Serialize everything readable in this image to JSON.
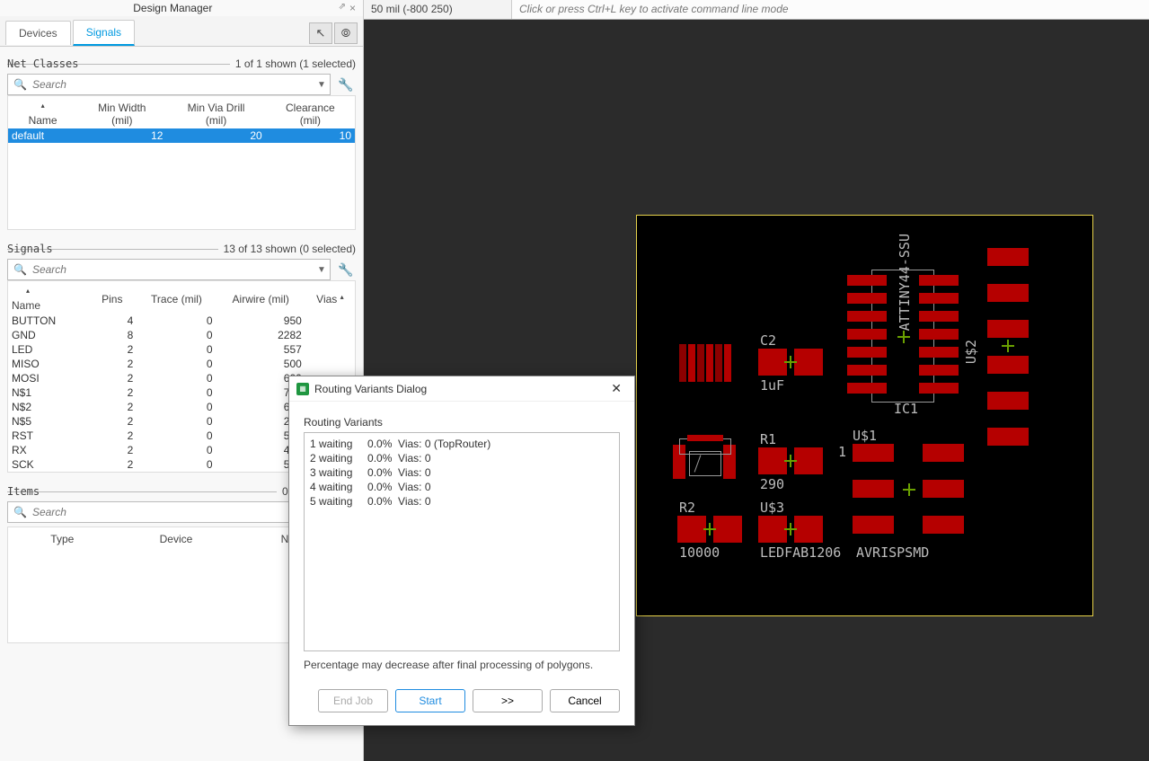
{
  "panel": {
    "title": "Design Manager",
    "pin_icon": "📌",
    "close_icon": "×"
  },
  "tabs": {
    "devices": "Devices",
    "signals": "Signals",
    "active": "signals"
  },
  "toolbar": {
    "select_icon": "↖",
    "fit_icon": "🔍"
  },
  "searchPlaceholder": "Search",
  "netClasses": {
    "label": "Net Classes",
    "meta": "1 of 1 shown (1 selected)",
    "headers": {
      "name": "Name",
      "minWidth": "Min Width\n(mil)",
      "minVia": "Min Via Drill\n(mil)",
      "clearance": "Clearance\n(mil)"
    },
    "rows": [
      {
        "name": "default",
        "minWidth": "12",
        "minVia": "20",
        "clearance": "10",
        "selected": true
      }
    ]
  },
  "signals": {
    "label": "Signals",
    "meta": "13 of 13 shown (0 selected)",
    "headers": {
      "name": "Name",
      "pins": "Pins",
      "trace": "Trace (mil)",
      "airwire": "Airwire (mil)",
      "vias": "Vias"
    },
    "rows": [
      {
        "name": "BUTTON",
        "pins": "4",
        "trace": "0",
        "airwire": "950"
      },
      {
        "name": "GND",
        "pins": "8",
        "trace": "0",
        "airwire": "2282"
      },
      {
        "name": "LED",
        "pins": "2",
        "trace": "0",
        "airwire": "557"
      },
      {
        "name": "MISO",
        "pins": "2",
        "trace": "0",
        "airwire": "500"
      },
      {
        "name": "MOSI",
        "pins": "2",
        "trace": "0",
        "airwire": "600"
      },
      {
        "name": "N$1",
        "pins": "2",
        "trace": "0",
        "airwire": "757"
      },
      {
        "name": "N$2",
        "pins": "2",
        "trace": "0",
        "airwire": "649"
      },
      {
        "name": "N$5",
        "pins": "2",
        "trace": "0",
        "airwire": "200"
      },
      {
        "name": "RST",
        "pins": "2",
        "trace": "0",
        "airwire": "586"
      },
      {
        "name": "RX",
        "pins": "2",
        "trace": "0",
        "airwire": "415"
      },
      {
        "name": "SCK",
        "pins": "2",
        "trace": "0",
        "airwire": "550"
      }
    ]
  },
  "items": {
    "label": "Items",
    "meta": "0 of 0 shown (0",
    "headers": {
      "type": "Type",
      "device": "Device",
      "name": "Name"
    }
  },
  "topbar": {
    "coordinates": "50 mil (-800 250)",
    "cmdline_placeholder": "Click or press Ctrl+L key to activate command line mode"
  },
  "board": {
    "labels": {
      "C2": "C2",
      "C2val": "1uF",
      "R1": "R1",
      "R1val": "290",
      "R2": "R2",
      "R2val": "10000",
      "U3": "U$3",
      "U3val": "LEDFAB1206",
      "IC1": "IC1",
      "IC1top": "ATTINY44-SSU",
      "U1": "U$1",
      "one": "1",
      "AVR": "AVRISPSMD",
      "U2": "U$2"
    }
  },
  "dialog": {
    "title": "Routing Variants Dialog",
    "section": "Routing Variants",
    "rows": [
      "1 waiting     0.0%  Vias: 0 (TopRouter)",
      "2 waiting     0.0%  Vias: 0",
      "3 waiting     0.0%  Vias: 0",
      "4 waiting     0.0%  Vias: 0",
      "5 waiting     0.0%  Vias: 0"
    ],
    "note": "Percentage may decrease after final processing of polygons.",
    "buttons": {
      "endJob": "End Job",
      "start": "Start",
      "next": ">>",
      "cancel": "Cancel"
    }
  }
}
